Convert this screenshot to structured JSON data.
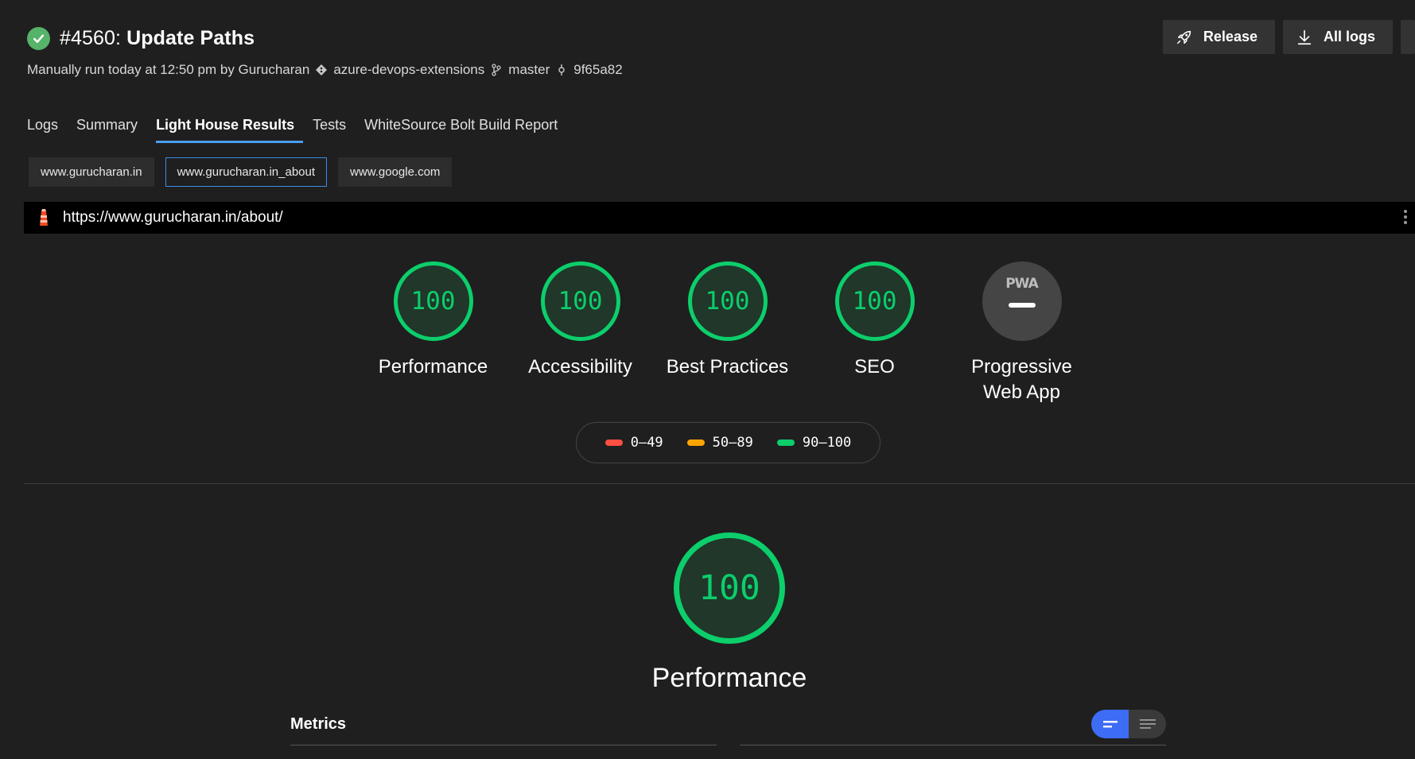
{
  "header": {
    "run_number": "#4560:",
    "title": "Update Paths",
    "run_info": "Manually run today at 12:50 pm by Gurucharan",
    "repo": "azure-devops-extensions",
    "branch": "master",
    "commit": "9f65a82"
  },
  "actions": {
    "release_label": "Release",
    "all_logs_label": "All logs"
  },
  "tabs": [
    {
      "label": "Logs",
      "active": false
    },
    {
      "label": "Summary",
      "active": false
    },
    {
      "label": "Light House Results",
      "active": true
    },
    {
      "label": "Tests",
      "active": false
    },
    {
      "label": "WhiteSource Bolt Build Report",
      "active": false
    }
  ],
  "url_tabs": [
    {
      "label": "www.gurucharan.in",
      "active": false
    },
    {
      "label": "www.gurucharan.in_about",
      "active": true
    },
    {
      "label": "www.google.com",
      "active": false
    }
  ],
  "report": {
    "url": "https://www.gurucharan.in/about/",
    "gauges": [
      {
        "score": "100",
        "label": "Performance"
      },
      {
        "score": "100",
        "label": "Accessibility"
      },
      {
        "score": "100",
        "label": "Best Practices"
      },
      {
        "score": "100",
        "label": "SEO"
      }
    ],
    "pwa": {
      "badge": "PWA",
      "label_line1": "Progressive",
      "label_line2": "Web App"
    },
    "legend": [
      {
        "range": "0–49",
        "color": "#ff4e42"
      },
      {
        "range": "50–89",
        "color": "#ffa400"
      },
      {
        "range": "90–100",
        "color": "#0cce6b"
      }
    ],
    "main_gauge": {
      "score": "100",
      "label": "Performance"
    },
    "metrics_title": "Metrics"
  },
  "colors": {
    "pass": "#0cce6b",
    "accent": "#4a9ff0",
    "toggle_active": "#3d6cf5"
  }
}
